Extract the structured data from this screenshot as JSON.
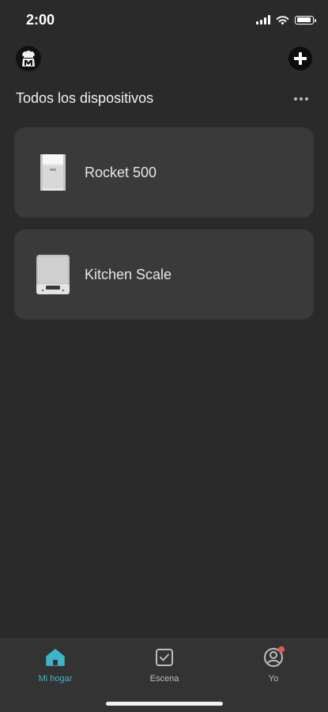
{
  "status_bar": {
    "time": "2:00"
  },
  "header": {
    "avatar_icon": "chef-avatar-icon",
    "add_icon": "plus-circle-icon",
    "section_title": "Todos los dispositivos",
    "more_icon": "more-horizontal-icon"
  },
  "devices": [
    {
      "name": "Rocket 500",
      "icon": "air-fryer-image"
    },
    {
      "name": "Kitchen Scale",
      "icon": "kitchen-scale-image"
    }
  ],
  "tab_bar": {
    "tabs": [
      {
        "label": "Mi hogar",
        "icon": "home-icon",
        "active": true
      },
      {
        "label": "Escena",
        "icon": "checkbox-icon",
        "active": false
      },
      {
        "label": "Yo",
        "icon": "profile-icon",
        "active": false,
        "badge": true
      }
    ]
  },
  "colors": {
    "background": "#2a2a2a",
    "card": "#3a3a3a",
    "tab_bar": "#333333",
    "accent": "#3fb6c8",
    "badge": "#e8554e"
  }
}
